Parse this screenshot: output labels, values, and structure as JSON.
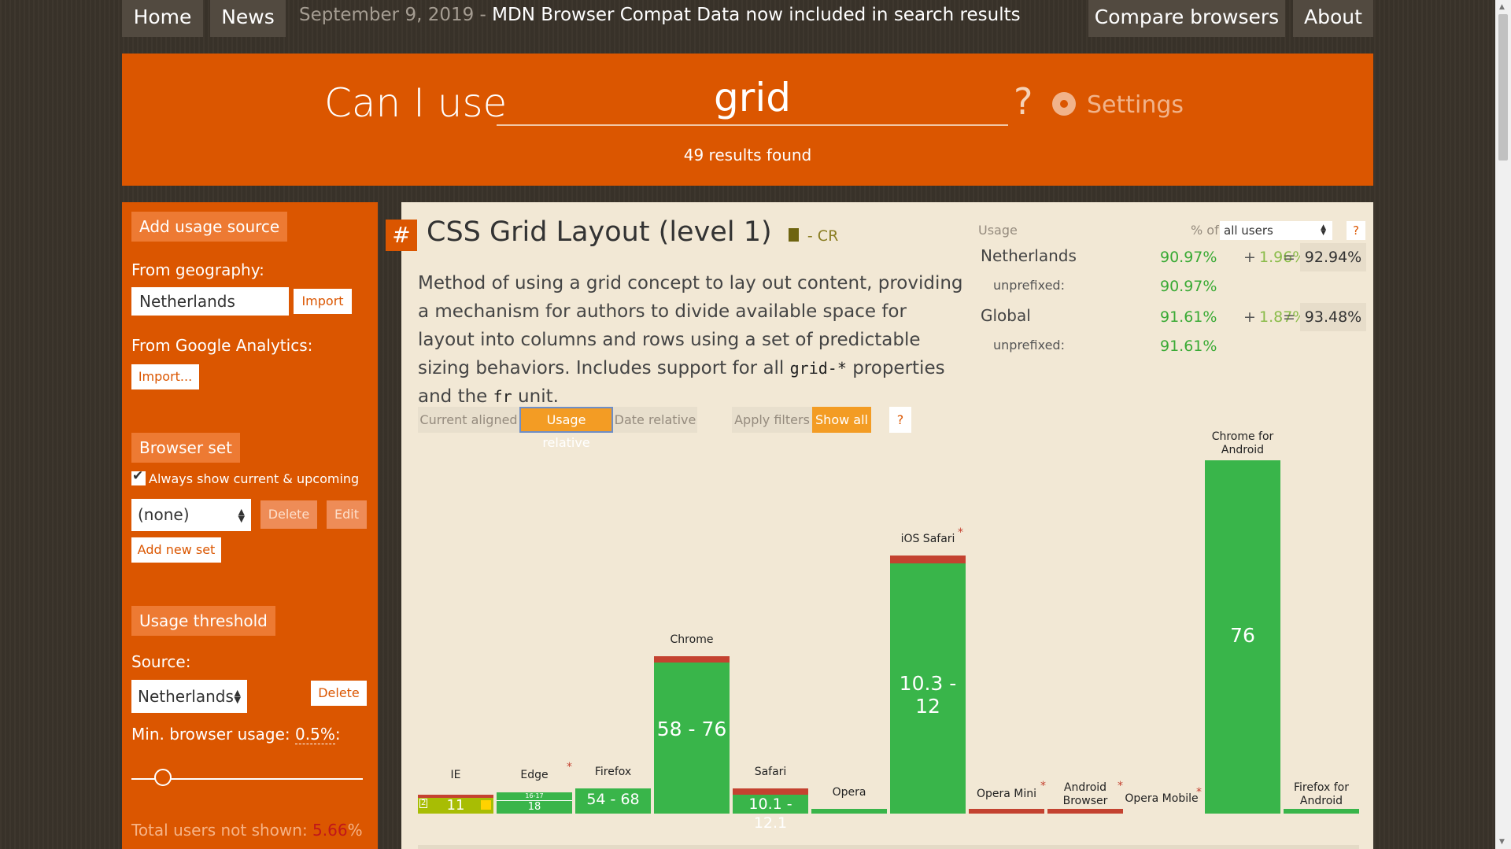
{
  "nav": {
    "home": "Home",
    "news": "News",
    "news_date": "September 9, 2019",
    "news_sep": " - ",
    "news_text": "MDN Browser Compat Data now included in search results",
    "compare": "Compare browsers",
    "about": "About"
  },
  "header": {
    "can_i_use": "Can I use",
    "search_value": "grid",
    "help": "?",
    "settings": "Settings",
    "results": "49 results found"
  },
  "sidebar": {
    "add_usage_source": "Add usage source",
    "from_geography": "From geography:",
    "geography_value": "Netherlands",
    "import": "Import",
    "from_ga": "From Google Analytics:",
    "ga_import": "Import...",
    "browser_set": "Browser set",
    "always_show": "Always show current & upcoming",
    "always_show_checked": true,
    "set_value": "(none)",
    "delete": "Delete",
    "edit": "Edit",
    "add_new_set": "Add new set",
    "usage_threshold": "Usage threshold",
    "source_label": "Source:",
    "source_value": "Netherlands",
    "source_delete": "Delete",
    "min_usage_label": "Min. browser usage:",
    "min_usage_value": "0.5%",
    "min_usage_colon": ":",
    "min_usage_slider": 0.1,
    "total_not_shown_label": "Total users not shown: ",
    "total_not_shown_value": "5.66",
    "total_not_shown_pct": "%"
  },
  "feature": {
    "hash": "#",
    "title": "CSS Grid Layout (level 1)",
    "status": "- CR",
    "desc_1": "Method of using a grid concept to lay out content, providing a mechanism for authors to divide available space for layout into columns and rows using a set of predictable sizing behaviors. Includes support for all ",
    "desc_code1": "grid-*",
    "desc_2": " properties and the ",
    "desc_code2": "fr",
    "desc_3": " unit."
  },
  "usage": {
    "label": "Usage",
    "pct_of": "% of",
    "users_select": "all users",
    "help": "?",
    "rows": [
      {
        "region": "Netherlands",
        "full": "90.97%",
        "plus": "+",
        "partial": "1.96%",
        "eq": "=",
        "total": "92.94%",
        "unprefixed_label": "unprefixed:",
        "unprefixed": "90.97%"
      },
      {
        "region": "Global",
        "full": "91.61%",
        "plus": "+",
        "partial": "1.87%",
        "eq": "=",
        "total": "93.48%",
        "unprefixed_label": "unprefixed:",
        "unprefixed": "91.61%"
      }
    ]
  },
  "filters": {
    "current_aligned": "Current aligned",
    "usage_relative": "Usage relative",
    "date_relative": "Date relative",
    "apply_filters": "Apply filters",
    "show_all": "Show all",
    "help": "?"
  },
  "colors": {
    "orange": "#db5600",
    "supported": "#39b54a",
    "partial": "#a8bd04",
    "unsupported": "#c44230",
    "panel": "#f2e8d5"
  },
  "browsers": {
    "ie": {
      "name": "IE",
      "version": "11",
      "note": "2",
      "star": false
    },
    "edge": {
      "name": "Edge",
      "version": "18",
      "prev": "16-17",
      "star": true
    },
    "firefox": {
      "name": "Firefox",
      "version": "54 - 68",
      "star": false
    },
    "chrome": {
      "name": "Chrome",
      "version": "58 - 76",
      "star": false
    },
    "safari": {
      "name": "Safari",
      "version": "10.1 - 12.1",
      "star": false
    },
    "opera": {
      "name": "Opera",
      "star": false
    },
    "ios": {
      "name": "iOS Safari",
      "version": "10.3 - 12",
      "star": true
    },
    "operamini": {
      "name": "Opera Mini",
      "star": true
    },
    "android": {
      "name": "Android Browser",
      "star": true
    },
    "operamob": {
      "name": "Opera Mobile",
      "star": true
    },
    "chromeand": {
      "name": "Chrome for Android",
      "version": "76",
      "star": false
    },
    "firefoxand": {
      "name": "Firefox for Android",
      "star": false
    }
  }
}
